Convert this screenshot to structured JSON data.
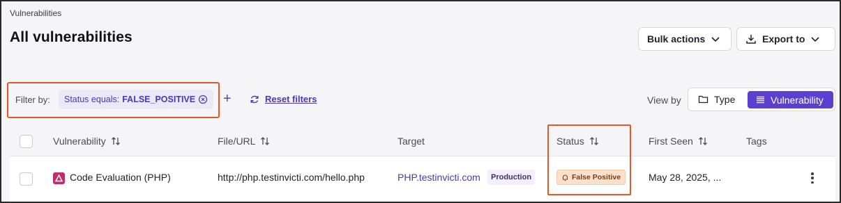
{
  "breadcrumb": "Vulnerabilities",
  "title": "All vulnerabilities",
  "header": {
    "bulk_actions_label": "Bulk actions",
    "export_label": "Export to"
  },
  "filters": {
    "label": "Filter by:",
    "chip_prefix": "Status equals:",
    "chip_value": "FALSE_POSITIVE",
    "add_symbol": "+",
    "reset_label": "Reset filters"
  },
  "view_by": {
    "label": "View by",
    "options": [
      "Type",
      "Vulnerability"
    ],
    "selected": "Vulnerability"
  },
  "table": {
    "columns": [
      "Vulnerability",
      "File/URL",
      "Target",
      "Status",
      "First Seen",
      "Tags"
    ],
    "rows": [
      {
        "vulnerability": "Code Evaluation (PHP)",
        "file_url": "http://php.testinvicti.com/hello.php",
        "target": "PHP.testinvicti.com",
        "target_tag": "Production",
        "status": "False Positive",
        "first_seen": "May 28, 2025, ...",
        "tags": ""
      }
    ]
  },
  "colors": {
    "accent": "#5b3fd1",
    "highlight_outline": "#e8542c",
    "severity_critical": "#c52a6a",
    "status_badge_bg": "#fbe1cc"
  }
}
